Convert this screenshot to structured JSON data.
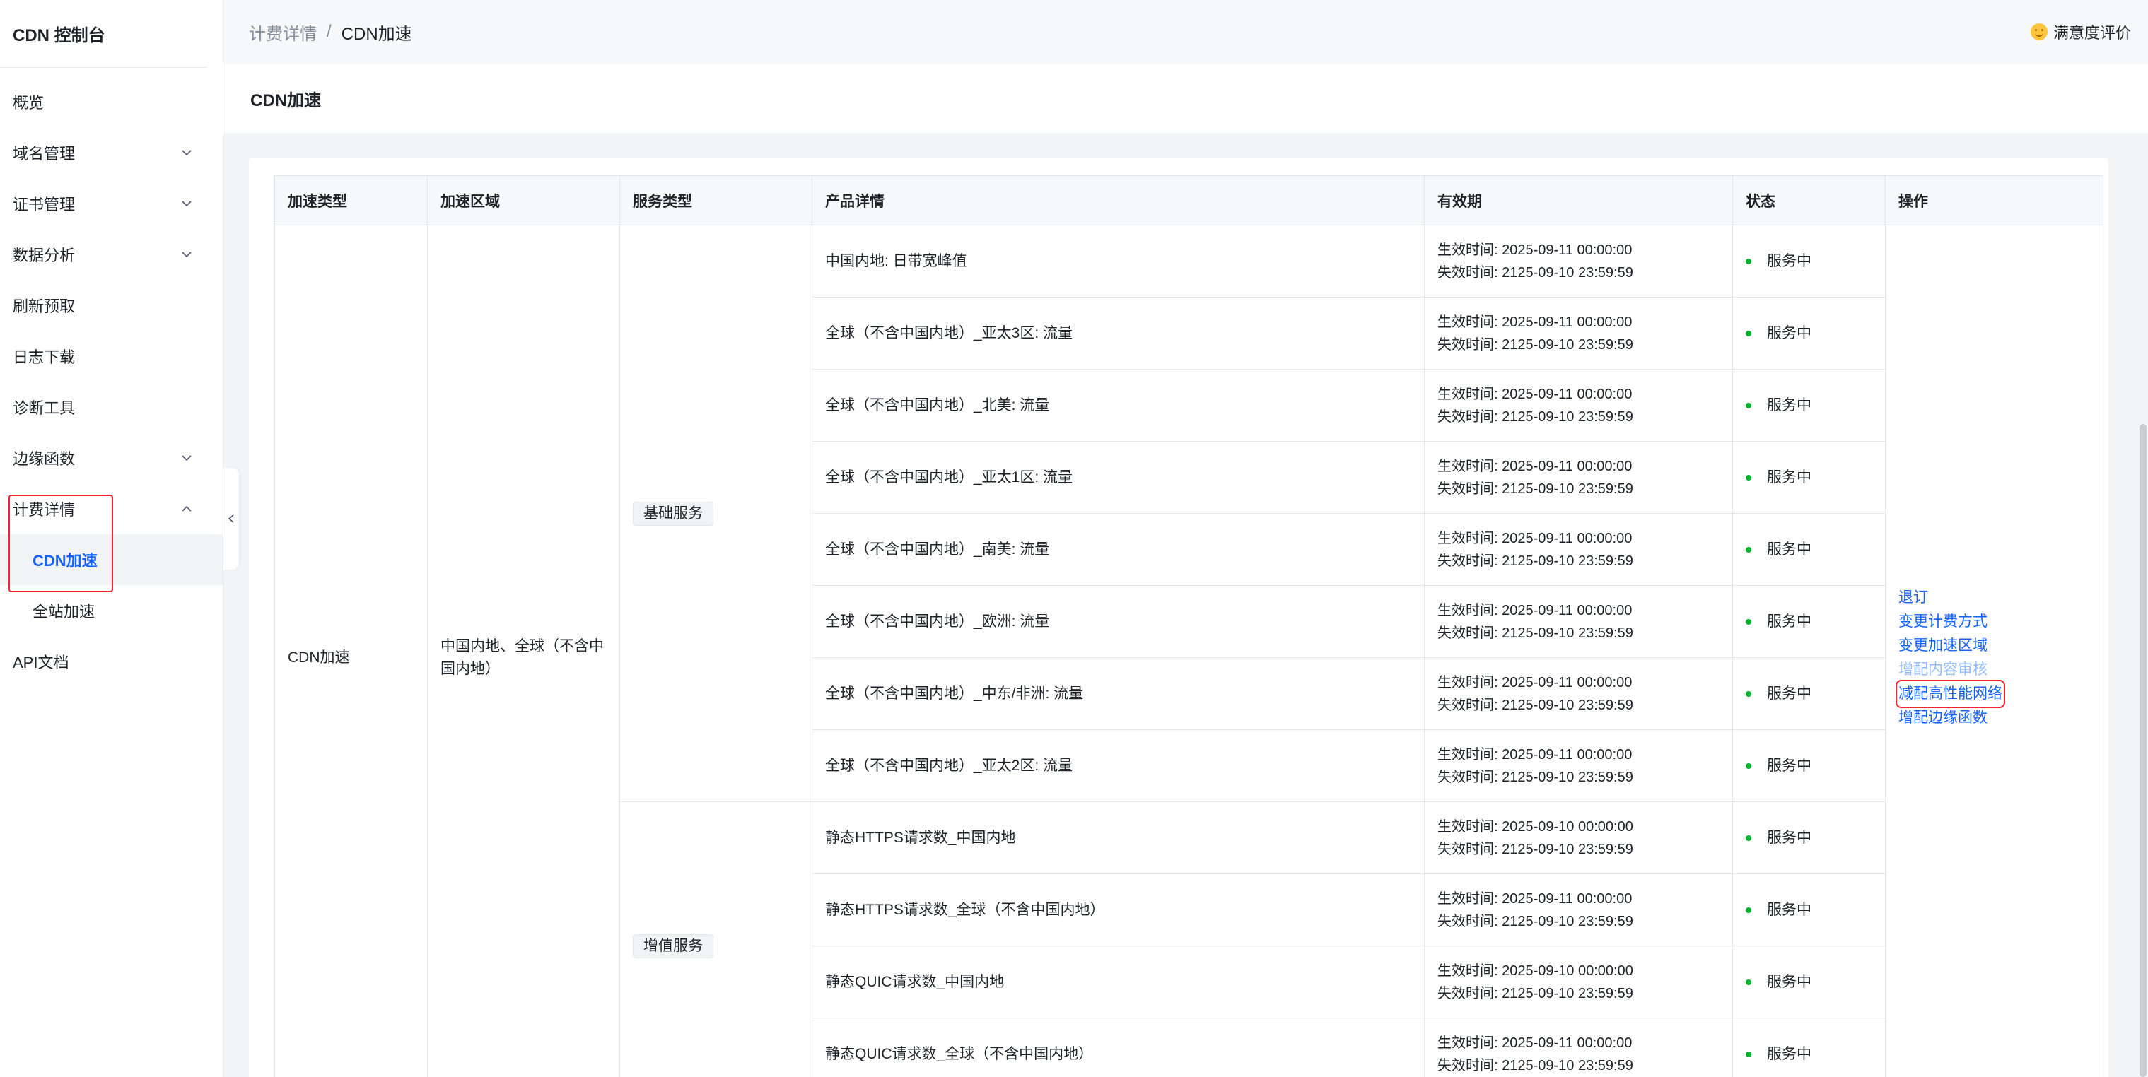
{
  "sidebar": {
    "title": "CDN 控制台",
    "items": [
      {
        "label": "概览"
      },
      {
        "label": "域名管理"
      },
      {
        "label": "证书管理"
      },
      {
        "label": "数据分析"
      },
      {
        "label": "刷新预取"
      },
      {
        "label": "日志下载"
      },
      {
        "label": "诊断工具"
      },
      {
        "label": "边缘函数"
      },
      {
        "label": "计费详情"
      },
      {
        "label": "CDN加速"
      },
      {
        "label": "全站加速"
      },
      {
        "label": "API文档"
      }
    ]
  },
  "breadcrumb": {
    "parent": "计费详情",
    "separator": "/",
    "current": "CDN加速"
  },
  "feedback": {
    "label": "满意度评价"
  },
  "page": {
    "title": "CDN加速"
  },
  "table": {
    "headers": [
      "加速类型",
      "加速区域",
      "服务类型",
      "产品详情",
      "有效期",
      "状态",
      "操作"
    ],
    "accel_type": "CDN加速",
    "accel_region": "中国内地、全球（不含中国内地）",
    "service_basic": "基础服务",
    "service_value": "增值服务",
    "rows": [
      {
        "product": "中国内地: 日带宽峰值",
        "start": "生效时间:   2025-09-11 00:00:00",
        "end": "失效时间:   2125-09-10 23:59:59",
        "status": "服务中"
      },
      {
        "product": "全球（不含中国内地）_亚太3区: 流量",
        "start": "生效时间:   2025-09-11 00:00:00",
        "end": "失效时间:   2125-09-10 23:59:59",
        "status": "服务中"
      },
      {
        "product": "全球（不含中国内地）_北美: 流量",
        "start": "生效时间:   2025-09-11 00:00:00",
        "end": "失效时间:   2125-09-10 23:59:59",
        "status": "服务中"
      },
      {
        "product": "全球（不含中国内地）_亚太1区: 流量",
        "start": "生效时间:   2025-09-11 00:00:00",
        "end": "失效时间:   2125-09-10 23:59:59",
        "status": "服务中"
      },
      {
        "product": "全球（不含中国内地）_南美: 流量",
        "start": "生效时间:   2025-09-11 00:00:00",
        "end": "失效时间:   2125-09-10 23:59:59",
        "status": "服务中"
      },
      {
        "product": "全球（不含中国内地）_欧洲: 流量",
        "start": "生效时间:   2025-09-11 00:00:00",
        "end": "失效时间:   2125-09-10 23:59:59",
        "status": "服务中"
      },
      {
        "product": "全球（不含中国内地）_中东/非洲: 流量",
        "start": "生效时间:   2025-09-11 00:00:00",
        "end": "失效时间:   2125-09-10 23:59:59",
        "status": "服务中"
      },
      {
        "product": "全球（不含中国内地）_亚太2区: 流量",
        "start": "生效时间:   2025-09-11 00:00:00",
        "end": "失效时间:   2125-09-10 23:59:59",
        "status": "服务中"
      },
      {
        "product": "静态HTTPS请求数_中国内地",
        "start": "生效时间:   2025-09-10 00:00:00",
        "end": "失效时间:   2125-09-10 23:59:59",
        "status": "服务中"
      },
      {
        "product": "静态HTTPS请求数_全球（不含中国内地）",
        "start": "生效时间:   2025-09-11 00:00:00",
        "end": "失效时间:   2125-09-10 23:59:59",
        "status": "服务中"
      },
      {
        "product": "静态QUIC请求数_中国内地",
        "start": "生效时间:   2025-09-10 00:00:00",
        "end": "失效时间:   2125-09-10 23:59:59",
        "status": "服务中"
      },
      {
        "product": "静态QUIC请求数_全球（不含中国内地）",
        "start": "生效时间:   2025-09-11 00:00:00",
        "end": "失效时间:   2125-09-10 23:59:59",
        "status": "服务中"
      }
    ],
    "actions": [
      "退订",
      "变更计费方式",
      "变更加速区域",
      "增配内容审核",
      "减配高性能网络",
      "增配边缘函数"
    ]
  },
  "colors": {
    "link": "#1664ff",
    "link_disabled": "#94bfff",
    "status_dot": "#00b42a",
    "highlight": "#f5222d"
  },
  "icons": {
    "chevron": "chevron-down-icon",
    "chevron_up": "chevron-up-icon",
    "collapse": "chevron-left-icon",
    "feedback": "smile-icon"
  }
}
